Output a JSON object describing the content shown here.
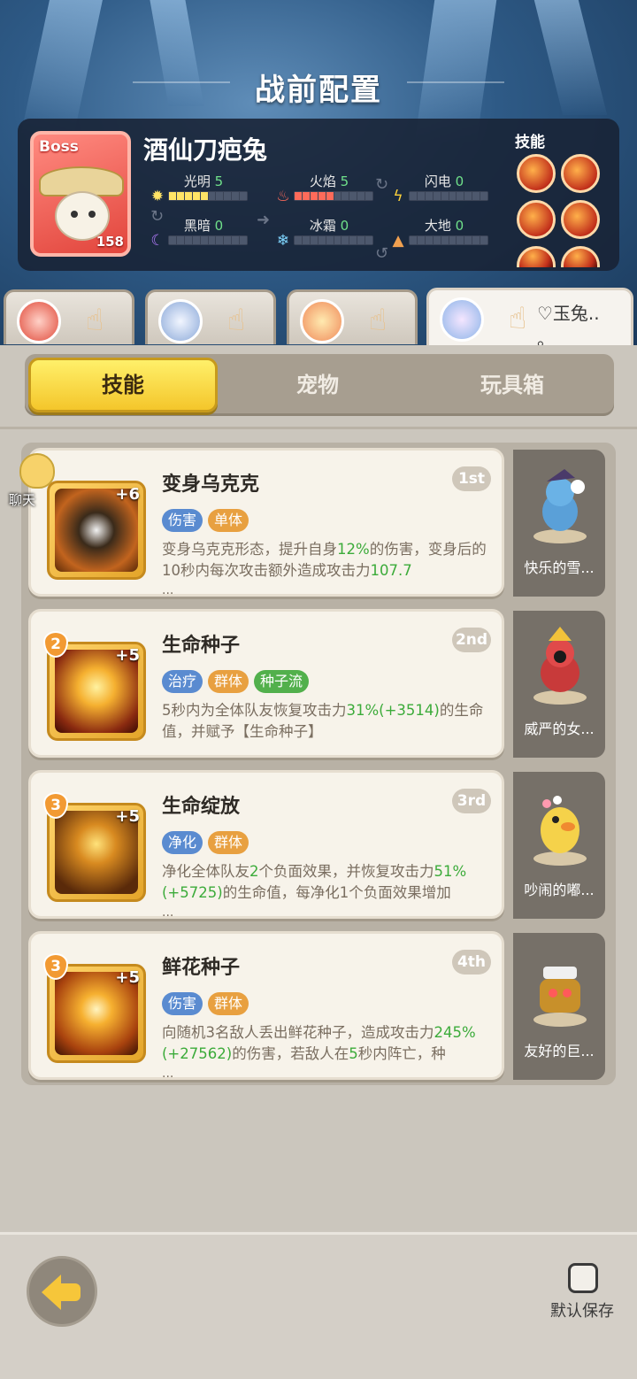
{
  "header": {
    "title": "战前配置"
  },
  "boss": {
    "badge": "Boss",
    "level": "158",
    "name": "酒仙刀疤兔",
    "elements": [
      {
        "name": "光明",
        "value": "5",
        "icon": "sun-icon",
        "color": "#ffe466"
      },
      {
        "name": "火焰",
        "value": "5",
        "icon": "fire-icon",
        "color": "#ff6b5a"
      },
      {
        "name": "闪电",
        "value": "0",
        "icon": "lightning-icon",
        "color": "#ffd23a"
      },
      {
        "name": "黑暗",
        "value": "0",
        "icon": "moon-icon",
        "color": "#b57cff"
      },
      {
        "name": "冰霜",
        "value": "0",
        "icon": "snowflake-icon",
        "color": "#7fd6ff"
      },
      {
        "name": "大地",
        "value": "0",
        "icon": "mountain-icon",
        "color": "#f0a050"
      }
    ],
    "skills_label": "技能"
  },
  "team": [
    {
      "name": ""
    },
    {
      "name": ""
    },
    {
      "name": ""
    },
    {
      "name": "♡玉兔.. 。"
    }
  ],
  "tabs": [
    "技能",
    "宠物",
    "玩具箱"
  ],
  "active_tab": "技能",
  "skills": [
    {
      "name": "变身乌克克",
      "rank": "1st",
      "plus": "+6",
      "level": "",
      "tags": [
        {
          "t": "伤害",
          "c": "blue"
        },
        {
          "t": "单体",
          "c": "orange"
        }
      ],
      "desc_parts": [
        "变身乌克克形态，提升自身",
        "12%",
        "的伤害，变身后的10秒内每次攻击额外造成攻击力",
        "107.7"
      ]
    },
    {
      "name": "生命种子",
      "rank": "2nd",
      "plus": "+5",
      "level": "2",
      "tags": [
        {
          "t": "治疗",
          "c": "blue"
        },
        {
          "t": "群体",
          "c": "orange"
        },
        {
          "t": "种子流",
          "c": "green"
        }
      ],
      "desc_parts": [
        "5秒内为全体队友恢复攻击力",
        "31%(+3514)",
        "的生命值，并赋予【生命种子】"
      ]
    },
    {
      "name": "生命绽放",
      "rank": "3rd",
      "plus": "+5",
      "level": "3",
      "tags": [
        {
          "t": "净化",
          "c": "blue"
        },
        {
          "t": "群体",
          "c": "orange"
        }
      ],
      "desc_parts": [
        "净化全体队友",
        "2",
        "个负面效果，并恢复攻击力",
        "51%(+5725)",
        "的生命值，每净化1个负面效果增加"
      ]
    },
    {
      "name": "鲜花种子",
      "rank": "4th",
      "plus": "+5",
      "level": "3",
      "tags": [
        {
          "t": "伤害",
          "c": "blue"
        },
        {
          "t": "群体",
          "c": "orange"
        }
      ],
      "desc_parts": [
        "向随机3名敌人丢出鲜花种子，造成攻击力",
        "245%(+27562)",
        "的伤害，若敌人在",
        "5",
        "秒内阵亡，种"
      ]
    }
  ],
  "ellipsis": "...",
  "pets": [
    "快乐的雪...",
    "威严的女...",
    "吵闹的嘟...",
    "友好的巨..."
  ],
  "chat": {
    "label": "聊天"
  },
  "footer": {
    "save_label": "默认保存"
  }
}
